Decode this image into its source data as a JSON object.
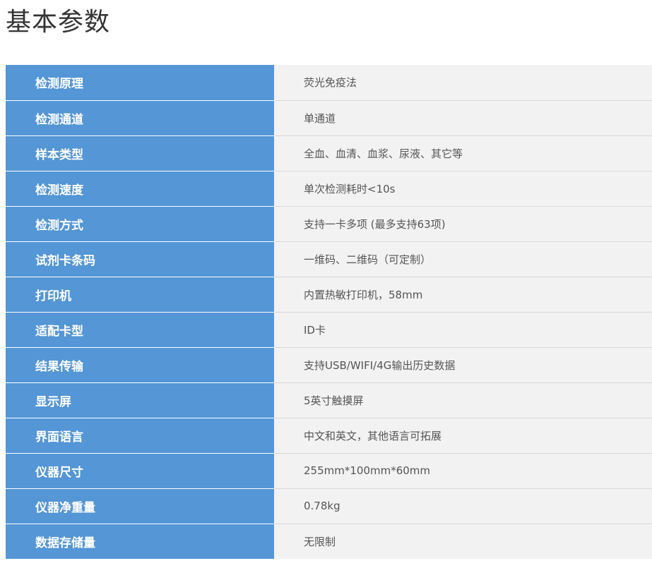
{
  "page": {
    "title": "基本参数"
  },
  "colors": {
    "label_background": "#5496d6",
    "value_background": "#f2f2f2"
  },
  "specs": [
    {
      "label": "检测原理",
      "value": "荧光免疫法"
    },
    {
      "label": "检测通道",
      "value": "单通道"
    },
    {
      "label": "样本类型",
      "value": "全血、血清、血浆、尿液、其它等"
    },
    {
      "label": "检测速度",
      "value": "单次检测耗时<10s"
    },
    {
      "label": "检测方式",
      "value": "支持一卡多项 (最多支持63项)"
    },
    {
      "label": "试剂卡条码",
      "value": "一维码、二维码（可定制）"
    },
    {
      "label": "打印机",
      "value": "内置热敏打印机，58mm"
    },
    {
      "label": "适配卡型",
      "value": "ID卡"
    },
    {
      "label": "结果传输",
      "value": "支持USB/WIFI/4G输出历史数据"
    },
    {
      "label": "显示屏",
      "value": "5英寸触摸屏"
    },
    {
      "label": "界面语言",
      "value": "中文和英文，其他语言可拓展"
    },
    {
      "label": "仪器尺寸",
      "value": "255mm*100mm*60mm"
    },
    {
      "label": "仪器净重量",
      "value": "0.78kg"
    },
    {
      "label": "数据存储量",
      "value": "无限制"
    }
  ]
}
